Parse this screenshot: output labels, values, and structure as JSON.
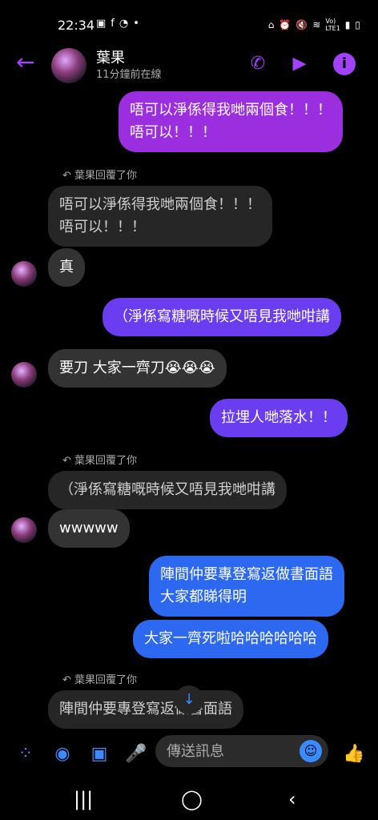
{
  "status": {
    "time": "22:34",
    "left_icons": [
      "image-icon",
      "facebook-icon",
      "whatsapp-icon",
      "•"
    ],
    "right_icons": [
      "battery-saver",
      "alarm",
      "mute",
      "wifi",
      "VoLTE",
      "signal",
      "battery"
    ]
  },
  "header": {
    "name": "葉果",
    "status": "11分鐘前在線"
  },
  "messages": {
    "m1": "唔可以淨係得我哋兩個食！！！\n唔可以！！！",
    "reply1_label": "葉果回覆了你",
    "reply1_quote": "唔可以淨係得我哋兩個食！！！\n唔可以！！！",
    "m2": "真",
    "m3": "（淨係寫糖嘅時候又唔見我哋咁講",
    "m4": "要刀 大家一齊刀😭😭😭",
    "m5": "拉埋人哋落水！！",
    "reply2_label": "葉果回覆了你",
    "reply2_quote": "（淨係寫糖嘅時候又唔見我哋咁講",
    "m6": "wwwww",
    "m7": "陣間仲要專登寫返做書面語\n大家都睇得明",
    "m8": "大家一齊死啦哈哈哈哈哈哈",
    "reply3_label": "葉果回覆了你",
    "reply3_quote": "陣間仲要專登寫返做書面語"
  },
  "composer": {
    "placeholder": "傳送訊息"
  },
  "colors": {
    "accent": "#a241ff",
    "blue": "#2c68f0"
  }
}
